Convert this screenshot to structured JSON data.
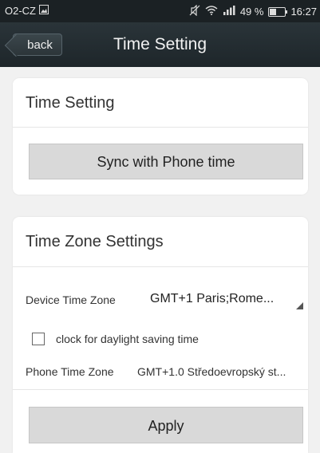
{
  "status_bar": {
    "carrier": "O2-CZ",
    "battery_percent": "49 %",
    "time": "16:27",
    "battery_level": 0.49,
    "icons": [
      "image-icon",
      "mute-icon",
      "wifi-icon",
      "signal-icon",
      "battery-icon"
    ]
  },
  "header": {
    "back_label": "back",
    "title": "Time Setting"
  },
  "time_setting_card": {
    "title": "Time Setting",
    "sync_button": "Sync with Phone time"
  },
  "time_zone_card": {
    "title": "Time Zone Settings",
    "device_tz_label": "Device Time Zone",
    "device_tz_value": "GMT+1 Paris;Rome...",
    "dst_label": "clock for daylight saving time",
    "dst_checked": false,
    "phone_tz_label": "Phone Time Zone",
    "phone_tz_value": "GMT+1.0  Středoevropský st...",
    "apply_button": "Apply"
  },
  "colors": {
    "header_bg": "#1e262a",
    "page_bg": "#f1f1f1",
    "button_bg": "#d9d9d9"
  }
}
